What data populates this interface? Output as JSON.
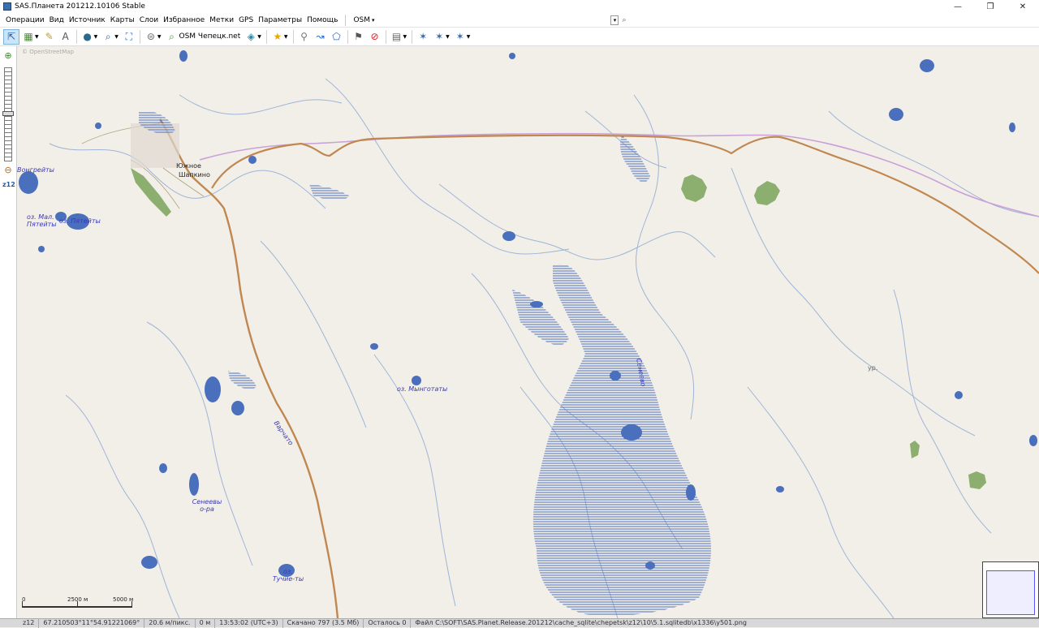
{
  "window": {
    "title": "SAS.Планета 201212.10106 Stable",
    "minimize_glyph": "—",
    "maximize_glyph": "❐",
    "close_glyph": "✕"
  },
  "menu": {
    "items": [
      "Операции",
      "Вид",
      "Источник",
      "Карты",
      "Слои",
      "Избранное",
      "Метки",
      "GPS",
      "Параметры",
      "Помощь"
    ],
    "map_select": "OSM",
    "address_value": "",
    "address_placeholder": ""
  },
  "toolbar": {
    "map_type_label": "OSM Чепецк.net",
    "buttons": [
      {
        "name": "pointer-icon",
        "glyph": "⇱"
      },
      {
        "name": "map-layers-icon",
        "glyph": "▦"
      },
      {
        "name": "ruler-icon",
        "glyph": "✎"
      },
      {
        "name": "text-icon",
        "glyph": "A"
      },
      {
        "name": "globe-icon",
        "glyph": "●"
      },
      {
        "name": "zoom-icon",
        "glyph": "⌕"
      },
      {
        "name": "fullscreen-icon",
        "glyph": "⛶"
      },
      {
        "name": "satellite-icon",
        "glyph": "⊜"
      },
      {
        "name": "star-icon",
        "glyph": "★"
      },
      {
        "name": "placemark-icon",
        "glyph": "⚲"
      },
      {
        "name": "path-icon",
        "glyph": "↝"
      },
      {
        "name": "polygon-icon",
        "glyph": "⬠"
      },
      {
        "name": "label-icon",
        "glyph": "⚑"
      },
      {
        "name": "hide-marks-icon",
        "glyph": "⊘"
      },
      {
        "name": "cache-icon",
        "glyph": "▤"
      },
      {
        "name": "gps-connect-icon",
        "glyph": "✶"
      },
      {
        "name": "gps-track-icon",
        "glyph": "✶"
      },
      {
        "name": "gps-center-icon",
        "glyph": "✶"
      }
    ]
  },
  "left_panel": {
    "zoom_label": "z12"
  },
  "map": {
    "attribution": "© OpenStreetMap",
    "labels": [
      {
        "text": "Вонгрейты",
        "kind": "water"
      },
      {
        "text": "Южное",
        "kind": "town"
      },
      {
        "text": "Шапкино",
        "kind": "town"
      },
      {
        "text": "оз. Мал. Пятейты",
        "kind": "water"
      },
      {
        "text": "оз. Пятейты",
        "kind": "water"
      },
      {
        "text": "оз. Мынготаты",
        "kind": "water"
      },
      {
        "text": "Сенеево",
        "kind": "water"
      },
      {
        "text": "Варчато",
        "kind": "water"
      },
      {
        "text": "Сенеевы о-ра",
        "kind": "water"
      },
      {
        "text": "оз. Тучие-ты",
        "kind": "water"
      },
      {
        "text": "ур.",
        "kind": "town"
      }
    ],
    "scale": {
      "zero": "0",
      "mid": "2500 м",
      "end": "5000 м"
    }
  },
  "status": {
    "zoom": "z12",
    "coords": "67.210503°11°54.91221069°",
    "scale": "20.6 м/пикс.",
    "distance": "0 м",
    "time": "13:53:02 (UTC+3)",
    "downloaded": "Скачано 797 (3.5 Мб)",
    "remaining": "Осталось 0",
    "file": "Файл C:\\SOFT\\SAS.Planet.Release.201212\\cache_sqlite\\chepetsk\\z12\\10\\5.1.sqlitedb\\x1336\\y501.png"
  },
  "colors": {
    "map_background": "#f2efe9",
    "water": "#4a6fbd",
    "road_primary": "#c08850",
    "boundary": "#c9a0d8",
    "forest": "#7aa35a"
  }
}
